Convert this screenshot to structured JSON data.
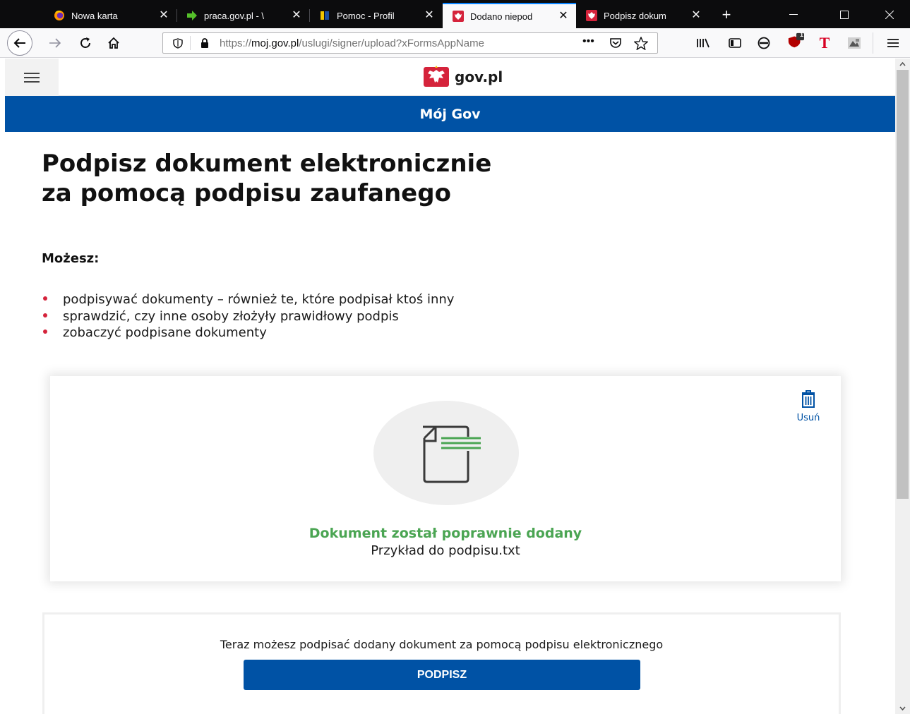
{
  "browser": {
    "tabs": [
      {
        "title": "Nowa karta",
        "favicon": "firefox-icon",
        "active": false
      },
      {
        "title": "praca.gov.pl - \\",
        "favicon": "arrow-favicon",
        "active": false
      },
      {
        "title": "Pomoc - Profil",
        "favicon": "ue-flag-favicon",
        "active": false
      },
      {
        "title": "Dodano niepod",
        "favicon": "gov-eagle-favicon",
        "active": true
      },
      {
        "title": "Podpisz dokum",
        "favicon": "gov-eagle-favicon",
        "active": false
      }
    ],
    "url": {
      "prefix": "https://",
      "host": "moj.gov.pl",
      "path": "/uslugi/signer/upload?xFormsAppName"
    },
    "addon_badge": "1",
    "accent_color": "#0a84ff"
  },
  "site": {
    "logo_text": "gov.pl",
    "bar_title": "Mój Gov",
    "brand_color": "#0052a5"
  },
  "content": {
    "title_line1": "Podpisz dokument elektronicznie",
    "title_line2": "za pomocą podpisu zaufanego",
    "can_title": "Możesz:",
    "bullets": [
      "podpisywać dokumenty – również te, które podpisał ktoś inny",
      "sprawdzić, czy inne osoby złożyły prawidłowy podpis",
      "zobaczyć podpisane dokumenty"
    ],
    "bullet_color": "#d5233b"
  },
  "upload": {
    "delete_label": "Usuń",
    "success_message": "Dokument został poprawnie dodany",
    "file_name": "Przykład do podpisu.txt",
    "success_color": "#4ba553"
  },
  "sign": {
    "prompt": "Teraz możesz podpisać dodany dokument za pomocą podpisu elektronicznego",
    "button_label": "PODPISZ"
  }
}
